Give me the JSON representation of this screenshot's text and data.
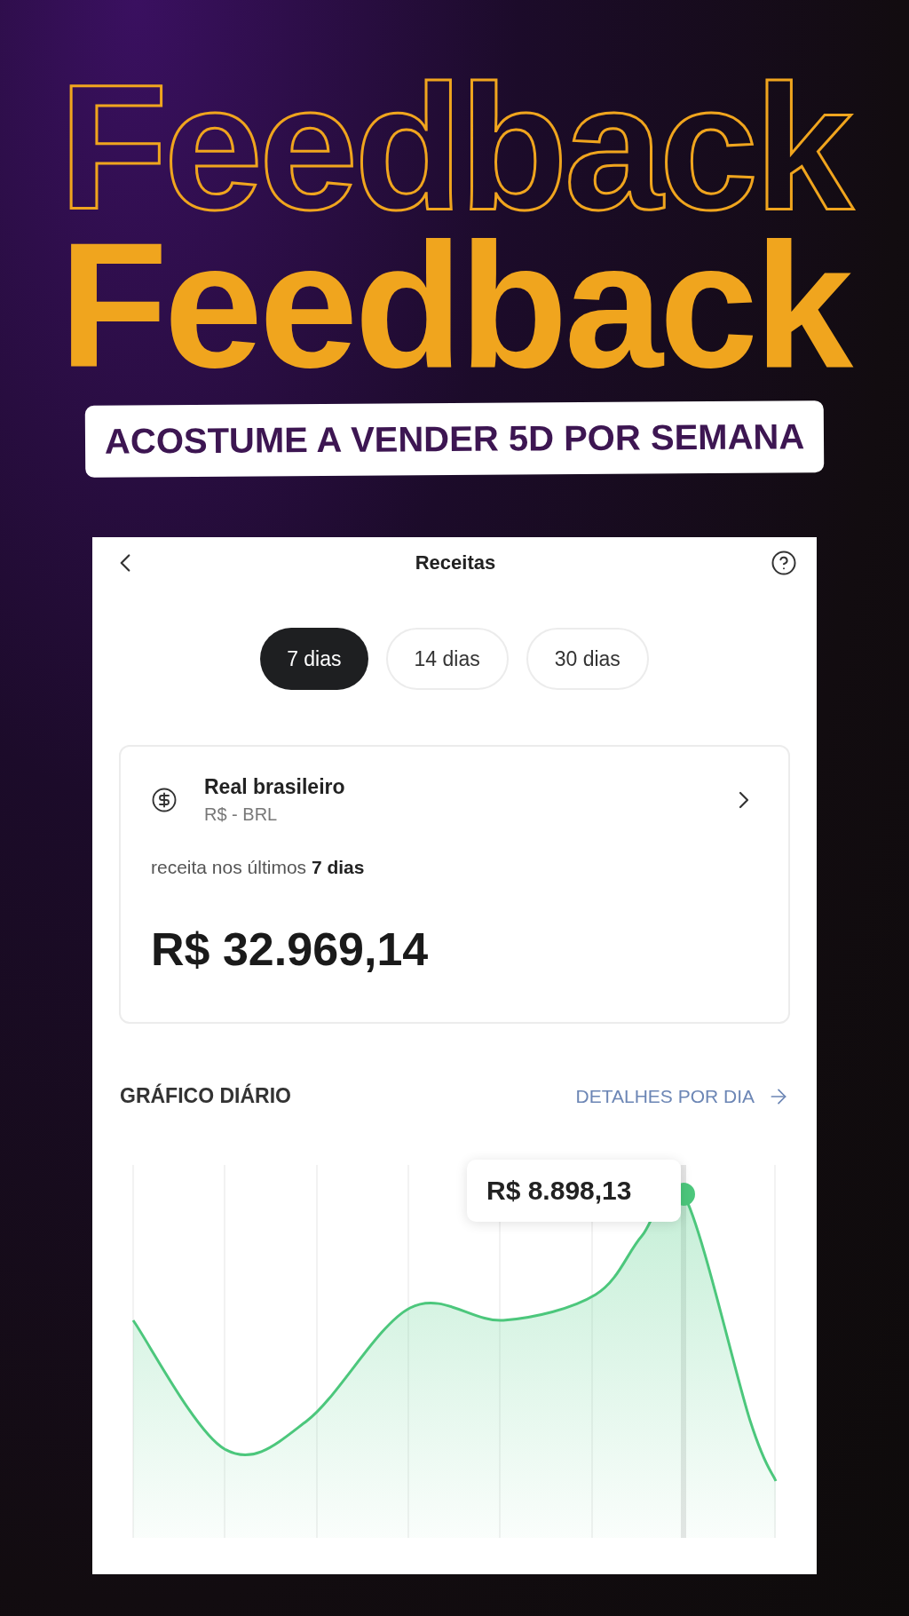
{
  "headline": {
    "outline_text": "Feedback",
    "solid_text": "Feedback"
  },
  "banner": "ACOSTUME A VENDER 5D POR SEMANA",
  "screen": {
    "title": "Receitas",
    "periods": [
      {
        "label": "7 dias",
        "selected": true
      },
      {
        "label": "14 dias",
        "selected": false
      },
      {
        "label": "30 dias",
        "selected": false
      }
    ],
    "currency_card": {
      "name": "Real brasileiro",
      "code": "R$ - BRL",
      "caption": "receita nos últimos **7 dias**",
      "amount": "R$ 32.969,14"
    },
    "chart_section": {
      "title": "GRÁFICO DIÁRIO",
      "link": "DETALHES POR DIA",
      "tooltip": "R$ 8.898,13"
    }
  }
}
